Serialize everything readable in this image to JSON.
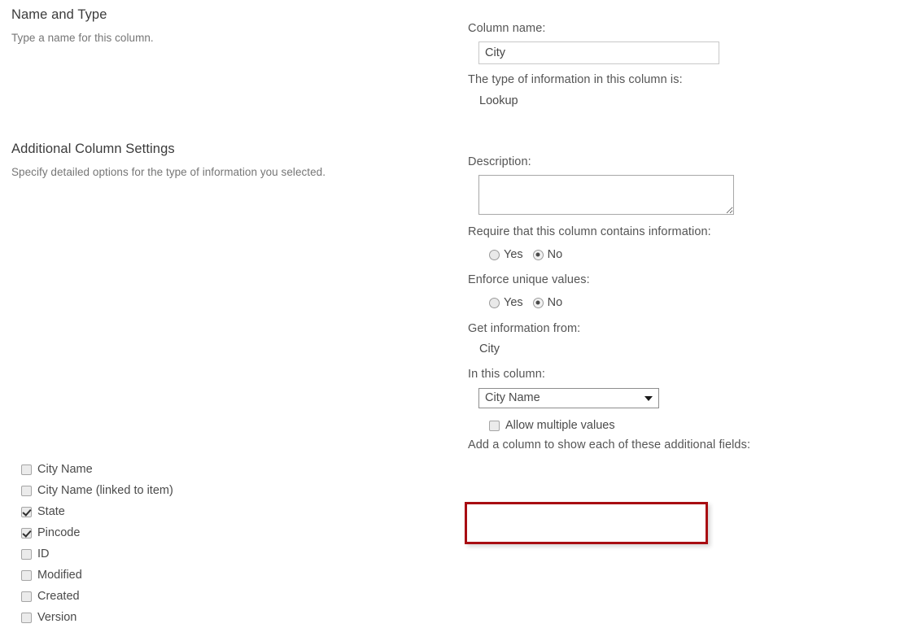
{
  "sections": {
    "name_and_type": {
      "heading": "Name and Type",
      "description": "Type a name for this column."
    },
    "additional_column_settings": {
      "heading": "Additional Column Settings",
      "description": "Specify detailed options for the type of information you selected."
    }
  },
  "form": {
    "column_name": {
      "label": "Column name:",
      "value": "City",
      "placeholder": ""
    },
    "type_of_information": {
      "label": "The type of information in this column is:",
      "value": "Lookup"
    },
    "description": {
      "label": "Description:",
      "value": "",
      "placeholder": ""
    },
    "require_information": {
      "label": "Require that this column contains information:",
      "options": [
        {
          "label": "Yes",
          "selected": false
        },
        {
          "label": "No",
          "selected": true
        }
      ]
    },
    "enforce_unique": {
      "label": "Enforce unique values:",
      "options": [
        {
          "label": "Yes",
          "selected": false
        },
        {
          "label": "No",
          "selected": true
        }
      ]
    },
    "get_information_from": {
      "label": "Get information from:",
      "value": "City"
    },
    "in_this_column": {
      "label": "In this column:",
      "selected": "City Name",
      "options": [
        "City Name",
        "State",
        "Pincode",
        "ID",
        "Modified",
        "Created",
        "Version"
      ]
    },
    "allow_multiple_values": {
      "label": "Allow multiple values",
      "checked": false
    },
    "additional_fields": {
      "label": "Add a column to show each of these additional fields:",
      "items": [
        {
          "label": "City Name",
          "checked": false
        },
        {
          "label": "City Name (linked to item)",
          "checked": false
        },
        {
          "label": "State",
          "checked": true
        },
        {
          "label": "Pincode",
          "checked": true
        },
        {
          "label": "ID",
          "checked": false
        },
        {
          "label": "Modified",
          "checked": false
        },
        {
          "label": "Created",
          "checked": false
        },
        {
          "label": "Version",
          "checked": false
        }
      ]
    }
  },
  "annotation": {
    "highlight_color": "#a80d12",
    "highlighted_items": [
      "State",
      "Pincode"
    ]
  },
  "colors": {
    "heading": "#3b3b3b",
    "body_text": "#767676",
    "label": "#555555",
    "value": "#4a4a4a",
    "input_border": "#c8c8c8",
    "background": "#ffffff"
  }
}
